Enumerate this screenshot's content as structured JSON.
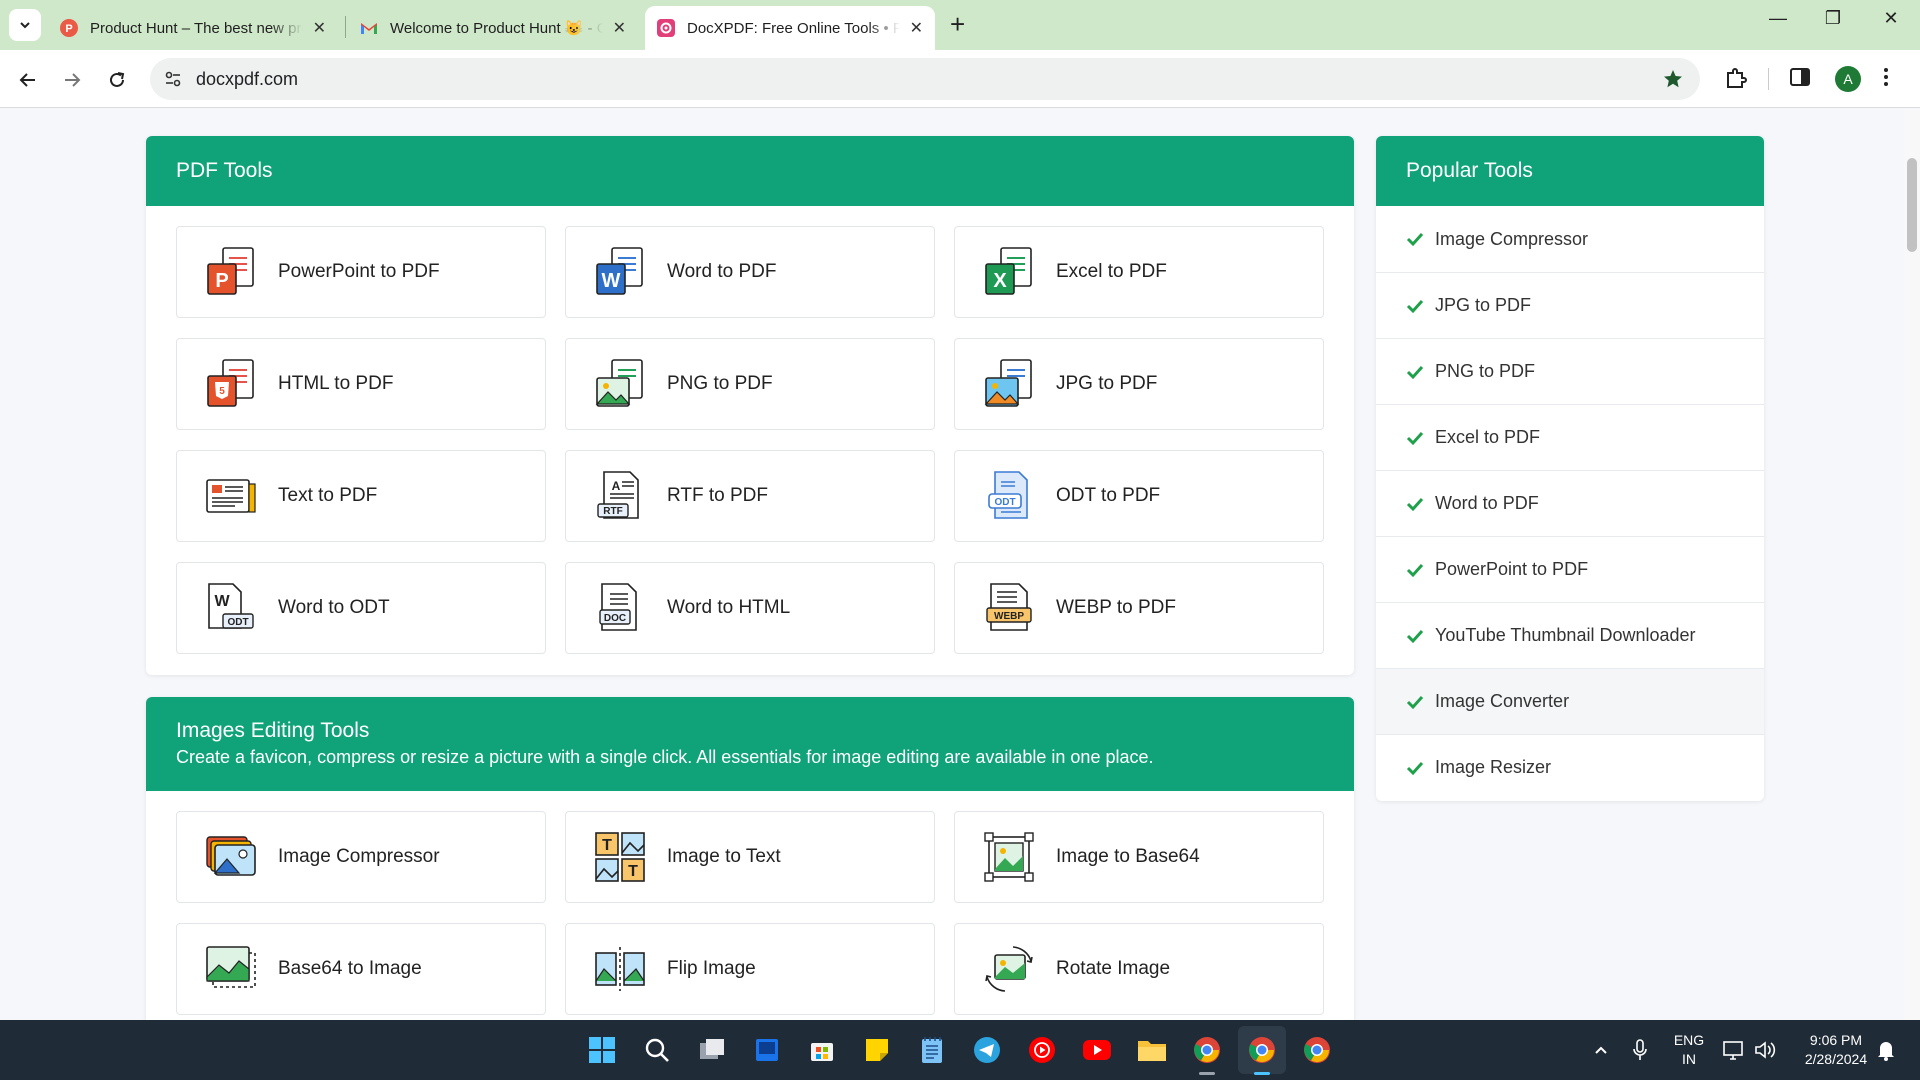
{
  "browser": {
    "tabs": [
      {
        "title": "Product Hunt – The best new products",
        "active": false,
        "favicon": "product-hunt-icon"
      },
      {
        "title": "Welcome to Product Hunt 😺 - Gmail",
        "active": false,
        "favicon": "gmail-icon"
      },
      {
        "title": "DocXPDF: Free Online Tools • Fast",
        "active": true,
        "favicon": "docxpdf-icon"
      }
    ],
    "url": "docxpdf.com",
    "profile_initial": "A",
    "new_tab_label": "+",
    "minimize_label": "—",
    "restore_label": "❐",
    "close_label": "✕"
  },
  "pdf_tools": {
    "title": "PDF Tools",
    "items": [
      {
        "label": "PowerPoint to PDF",
        "icon": "powerpoint-icon"
      },
      {
        "label": "Word to PDF",
        "icon": "word-icon"
      },
      {
        "label": "Excel to PDF",
        "icon": "excel-icon"
      },
      {
        "label": "HTML to PDF",
        "icon": "html5-icon"
      },
      {
        "label": "PNG to PDF",
        "icon": "png-image-icon"
      },
      {
        "label": "JPG to PDF",
        "icon": "jpg-image-icon"
      },
      {
        "label": "Text to PDF",
        "icon": "text-document-icon"
      },
      {
        "label": "RTF to PDF",
        "icon": "rtf-file-icon"
      },
      {
        "label": "ODT to PDF",
        "icon": "odt-file-icon"
      },
      {
        "label": "Word to ODT",
        "icon": "word-odt-icon"
      },
      {
        "label": "Word to HTML",
        "icon": "doc-file-icon"
      },
      {
        "label": "WEBP to PDF",
        "icon": "webp-file-icon"
      }
    ]
  },
  "image_tools": {
    "title": "Images Editing Tools",
    "subtitle": "Create a favicon, compress or resize a picture with a single click. All essentials for image editing are available in one place.",
    "items": [
      {
        "label": "Image Compressor",
        "icon": "image-stack-icon"
      },
      {
        "label": "Image to Text",
        "icon": "image-text-icon"
      },
      {
        "label": "Image to Base64",
        "icon": "image-frame-icon"
      },
      {
        "label": "Base64 to Image",
        "icon": "image-dashed-icon"
      },
      {
        "label": "Flip Image",
        "icon": "flip-image-icon"
      },
      {
        "label": "Rotate Image",
        "icon": "rotate-image-icon"
      }
    ]
  },
  "popular_tools": {
    "title": "Popular Tools",
    "items": [
      "Image Compressor",
      "JPG to PDF",
      "PNG to PDF",
      "Excel to PDF",
      "Word to PDF",
      "PowerPoint to PDF",
      "YouTube Thumbnail Downloader",
      "Image Converter",
      "Image Resizer"
    ]
  },
  "taskbar": {
    "language": "ENG",
    "region": "IN",
    "time": "9:06 PM",
    "date": "2/28/2024"
  },
  "colors": {
    "brand_green": "#10a37a",
    "check_green": "#1fa04b",
    "tabstrip": "#cfe8c9",
    "taskbar": "#1f2b36"
  }
}
